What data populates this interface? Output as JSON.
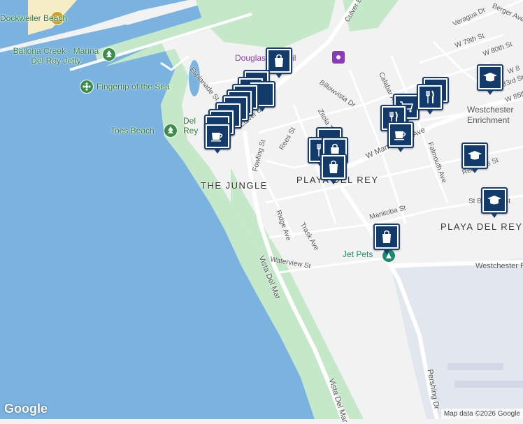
{
  "map": {
    "area_labels": [
      "THE JUNGLE",
      "PLAYA DEL REY",
      "PLAYA DEL REY"
    ],
    "street_labels": [
      "Culver Blvd",
      "Vista Del Mar",
      "Vista Del Mar",
      "Pershing Dr",
      "W Manchester Ave",
      "Westchester Pkwy",
      "Esplanade St",
      "Vista Del Mar",
      "Fowling St",
      "Rees St",
      "Zitola Ter",
      "Billowvista Dr",
      "Calabar Ave",
      "Falmouth Ave",
      "Ridge Ave",
      "Trask Ave",
      "Waterview St",
      "Manitoba St",
      "Redlands St",
      "St Bernard St",
      "Veragua Dr",
      "Berger Ave",
      "W 79th St",
      "W 80th St",
      "W 83rd St",
      "W 85th St",
      "W 8"
    ],
    "poi_labels": [
      "Dockweiler Beach",
      "Ballona Creek - Marina Del Rey Jetty",
      "Fingertip of the Sea",
      "Toes Beach",
      "Del Rey Lagoon Park",
      "Douglas Fir Trail",
      "Jet Pets",
      "Westchester Enrichment Sciences Magnet"
    ],
    "attribution": "Map data ©2026 Google",
    "logo": "Google",
    "colors": {
      "water": "#7ab3df",
      "park": "#c4e8c8",
      "land": "#f2f2f2",
      "road": "#ffffff",
      "airport": "#e1e6ef",
      "marker_fill": "#123a6a"
    },
    "markers": [
      {
        "icon": "shopping-bag"
      },
      {
        "icon": "coffee-cup"
      },
      {
        "icon": "coffee-cup"
      },
      {
        "icon": "coffee-cup"
      },
      {
        "icon": "coffee-cup"
      },
      {
        "icon": "coffee-cup"
      },
      {
        "icon": "coffee-cup"
      },
      {
        "icon": "coffee-cup"
      },
      {
        "icon": "restaurant"
      },
      {
        "icon": "restaurant"
      },
      {
        "icon": "coffee-cup"
      },
      {
        "icon": "restaurant"
      },
      {
        "icon": "shopping-bag"
      },
      {
        "icon": "shopping-bag"
      },
      {
        "icon": "restaurant"
      },
      {
        "icon": "shopping-cart"
      },
      {
        "icon": "restaurant"
      },
      {
        "icon": "coffee-cup"
      },
      {
        "icon": "school"
      },
      {
        "icon": "school"
      },
      {
        "icon": "school"
      },
      {
        "icon": "shopping-bag"
      }
    ]
  }
}
